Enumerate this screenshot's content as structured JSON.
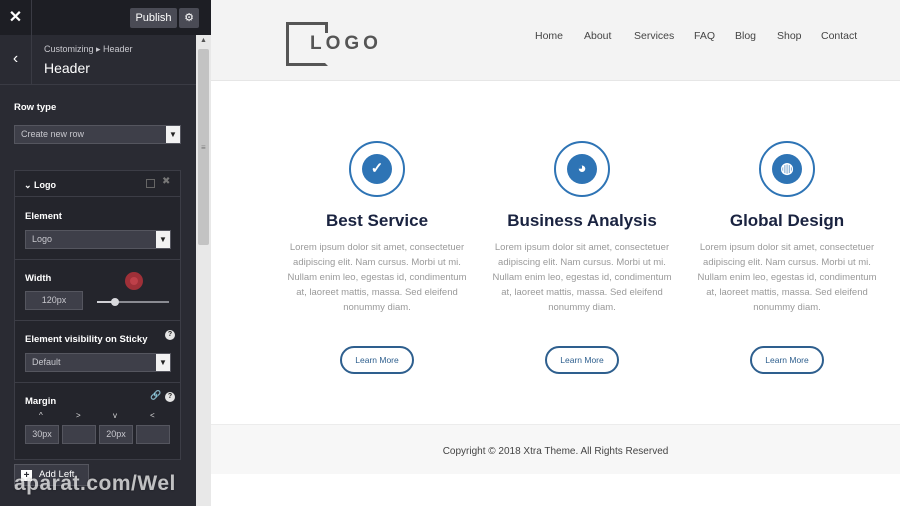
{
  "customizer": {
    "close_icon": "close-icon",
    "publish_label": "Publish",
    "gear_icon": "gear-icon",
    "breadcrumb": "Customizing ▸ Header",
    "title": "Header",
    "row_type_label": "Row type",
    "row_type_value": "Create new row",
    "panel_title": "Logo",
    "element_label": "Element",
    "element_value": "Logo",
    "width_label": "Width",
    "width_value": "120px",
    "width_slider_level": 0.25,
    "visibility_label": "Element visibility on Sticky",
    "visibility_value": "Default",
    "margin_label": "Margin",
    "margin_arrows": [
      "^",
      ">",
      "v",
      "<"
    ],
    "margin_values": [
      "30px",
      "",
      "20px",
      ""
    ],
    "add_left_label": "Add Left"
  },
  "site": {
    "logo_text": "LOGO",
    "nav": [
      "Home",
      "About",
      "Services",
      "FAQ",
      "Blog",
      "Shop",
      "Contact"
    ],
    "features": [
      {
        "icon": "check-icon",
        "title": "Best Service",
        "text": "Lorem ipsum dolor sit amet, consectetuer adipiscing elit. Nam cursus. Morbi ut mi. Nullam enim leo, egestas id, condimentum at, laoreet mattis, massa. Sed eleifend nonummy diam.",
        "button": "Learn More"
      },
      {
        "icon": "pie-chart-icon",
        "title": "Business Analysis",
        "text": "Lorem ipsum dolor sit amet, consectetuer adipiscing elit. Nam cursus. Morbi ut mi. Nullam enim leo, egestas id, condimentum at, laoreet mattis, massa. Sed eleifend nonummy diam.",
        "button": "Learn More"
      },
      {
        "icon": "globe-icon",
        "title": "Global Design",
        "text": "Lorem ipsum dolor sit amet, consectetuer adipiscing elit. Nam cursus. Morbi ut mi. Nullam enim leo, egestas id, condimentum at, laoreet mattis, massa. Sed eleifend nonummy diam.",
        "button": "Learn More"
      }
    ],
    "copyright": "Copyright © 2018 Xtra Theme. All Rights Reserved"
  },
  "watermark": "aparat.com/Wel",
  "colors": {
    "accent": "#2e74b5",
    "sidebar_bg": "#2a2b33",
    "heading": "#1a2340"
  }
}
